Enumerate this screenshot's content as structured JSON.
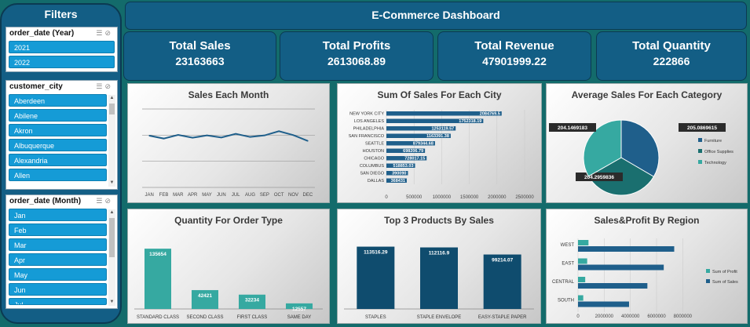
{
  "sidebar": {
    "title": "Filters",
    "slicers": [
      {
        "title": "order_date (Year)",
        "items": [
          "2021",
          "2022"
        ]
      },
      {
        "title": "customer_city",
        "items": [
          "Aberdeen",
          "Abilene",
          "Akron",
          "Albuquerque",
          "Alexandria",
          "Allen"
        ]
      },
      {
        "title": "order_date (Month)",
        "items": [
          "Jan",
          "Feb",
          "Mar",
          "Apr",
          "May",
          "Jun",
          "Jul"
        ]
      }
    ]
  },
  "header": {
    "title": "E-Commerce Dashboard"
  },
  "kpis": [
    {
      "label": "Total Sales",
      "value": "23163663"
    },
    {
      "label": "Total Profits",
      "value": "2613068.89"
    },
    {
      "label": "Total Revenue",
      "value": "47901999.22"
    },
    {
      "label": "Total Quantity",
      "value": "222866"
    }
  ],
  "colors": {
    "primary": "#135e85",
    "dark": "#0b3a52",
    "teal": "#36a9a1",
    "slicer_item": "#159bd6",
    "background": "#136b6b"
  },
  "icons": [
    "multi-select-icon",
    "clear-filter-icon"
  ],
  "chart_data": [
    {
      "type": "line",
      "title": "Sales Each Month",
      "categories": [
        "JAN",
        "FEB",
        "MAR",
        "APR",
        "MAY",
        "JUN",
        "JUL",
        "AUG",
        "SEP",
        "OCT",
        "NOV",
        "DEC"
      ],
      "values": [
        1980000,
        1870000,
        2010000,
        1900000,
        1990000,
        1910000,
        2050000,
        1930000,
        1990000,
        2150000,
        2000000,
        1780000
      ],
      "ylim": [
        0,
        3000000
      ],
      "grid": true,
      "color": "#1f5f8b"
    },
    {
      "type": "bar",
      "orientation": "horizontal",
      "title": "Sum Of Sales For Each City",
      "categories": [
        "NEW YORK CITY",
        "LOS ANGELES",
        "PHILADELPHIA",
        "SAN FRANCISCO",
        "SEATTLE",
        "HOUSTON",
        "CHICAGO",
        "COLUMBUS",
        "SAN DIEGO",
        "DALLAS"
      ],
      "values": [
        2084769.5,
        1752318.19,
        1253119.57,
        1163391.38,
        879344.68,
        698206.79,
        728017.15,
        518853.03,
        390090,
        368431
      ],
      "labels": [
        "2084769.5",
        "1752318.19",
        "1253119.57",
        "1163391.38",
        "879344.68",
        "698206.79",
        "728017.15",
        "518853.03",
        "390090",
        "368431"
      ],
      "xticks": [
        "0",
        "500000",
        "1000000",
        "1500000",
        "2000000",
        "2500000"
      ],
      "xlim": [
        0,
        2500000
      ],
      "color": "#1f5f8b"
    },
    {
      "type": "pie",
      "title": "Average Sales For Each Category",
      "slices": [
        {
          "name": "Furniture",
          "value": 205.0869615,
          "label": "205.0869615",
          "color": "#1f5f8b"
        },
        {
          "name": "Office Supplies",
          "value": 204.2959836,
          "label": "204.2959836",
          "color": "#1a6f6f"
        },
        {
          "name": "Technology",
          "value": 204.1469183,
          "label": "204.1469183",
          "color": "#36a9a1"
        }
      ],
      "legend": "right"
    },
    {
      "type": "bar",
      "title": "Quantity For Order Type",
      "categories": [
        "STANDARD CLASS",
        "SECOND CLASS",
        "FIRST CLASS",
        "SAME DAY"
      ],
      "values": [
        135654,
        42421,
        32234,
        12557
      ],
      "labels": [
        "135654",
        "42421",
        "32234",
        "12557"
      ],
      "ylim": [
        0,
        150000
      ],
      "color": "#36a9a1"
    },
    {
      "type": "bar",
      "title": "Top 3 Products By Sales",
      "categories": [
        "STAPLES",
        "STAPLE ENVELOPE",
        "EASY-STAPLE PAPER"
      ],
      "values": [
        113516.29,
        112116.9,
        99214.07
      ],
      "labels": [
        "113516.29",
        "112116.9",
        "99214.07"
      ],
      "ylim": [
        0,
        130000
      ],
      "color": "#0f4c6e"
    },
    {
      "type": "bar",
      "orientation": "horizontal",
      "title": "Sales&Profit By Region",
      "categories": [
        "WEST",
        "EAST",
        "CENTRAL",
        "SOUTH"
      ],
      "series": [
        {
          "name": "Sum of Profit",
          "values": [
            800000,
            700000,
            550000,
            400000
          ],
          "color": "#36a9a1"
        },
        {
          "name": "Sum of Sales",
          "values": [
            7350000,
            6550000,
            5300000,
            3900000
          ],
          "color": "#1f5f8b"
        }
      ],
      "xticks": [
        "0",
        "2000000",
        "4000000",
        "6000000",
        "8000000"
      ],
      "xlim": [
        0,
        9000000
      ],
      "legend": "right"
    }
  ]
}
